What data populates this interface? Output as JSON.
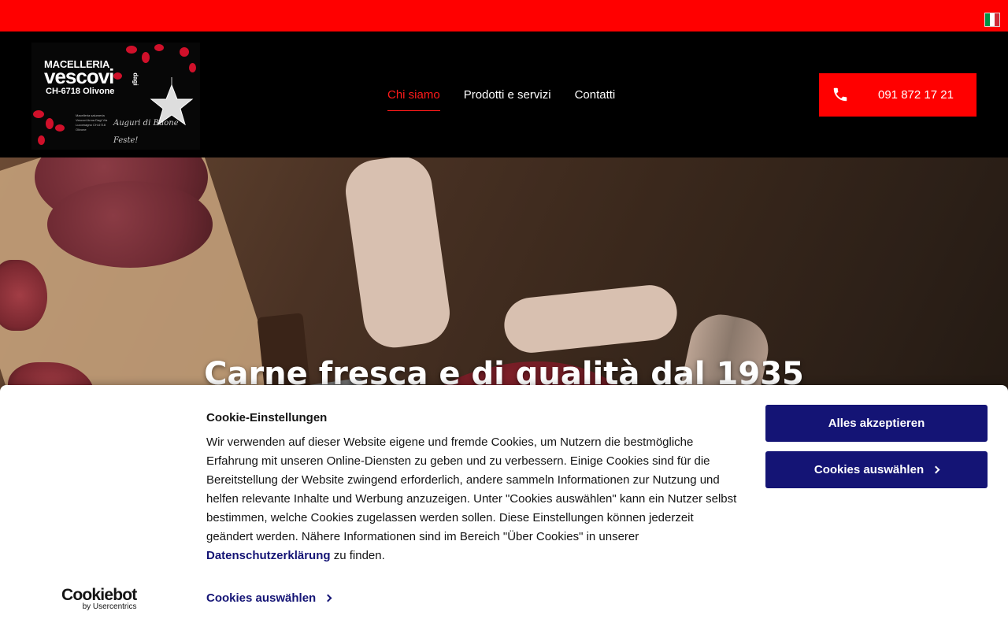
{
  "header": {
    "logo": {
      "line1": "MACELLERIA",
      "line2": "vescovi",
      "line2b": "dagi",
      "line3": "CH-6718 Olivone",
      "small_text": "Macelleria salumeria Vescovi Anna Dagi Via Lucomagno CH-6718 Olivone",
      "script_text": "Auguri di Buone Feste!"
    },
    "nav": [
      {
        "label": "Chi siamo",
        "active": true
      },
      {
        "label": "Prodotti e servizi",
        "active": false
      },
      {
        "label": "Contatti",
        "active": false
      }
    ],
    "phone": "091 872 17 21",
    "language_flag": "italian-flag-icon"
  },
  "hero": {
    "title": "Carne fresca e di qualità dal 1935"
  },
  "cookie_banner": {
    "title": "Cookie-Einstellungen",
    "body_text": "Wir verwenden auf dieser Website eigene und fremde Cookies, um Nutzern die bestmögliche Erfahrung mit unseren Online-Diensten zu geben und zu verbessern. Einige Cookies sind für die Bereitstellung der Website zwingend erforderlich, andere sammeln Informationen zur Nutzung und helfen relevante Inhalte und Werbung anzuzeigen. Unter \"Cookies auswählen\" kann ein Nutzer selbst bestimmen, welche Cookies zugelassen werden sollen. Diese Einstellungen können jederzeit geändert werden. Nähere Informationen sind im Bereich \"Über Cookies\" in unserer",
    "privacy_link": "Datenschutzerklärung",
    "body_suffix": "zu finden.",
    "select_link": "Cookies auswählen",
    "accept_button": "Alles akzeptieren",
    "choose_button": "Cookies auswählen",
    "brand": "Cookiebot",
    "brand_by": "by Usercentrics"
  },
  "colors": {
    "brand_red": "#ff0000",
    "cookie_button": "#141475",
    "active_nav": "#ff1a1a"
  }
}
